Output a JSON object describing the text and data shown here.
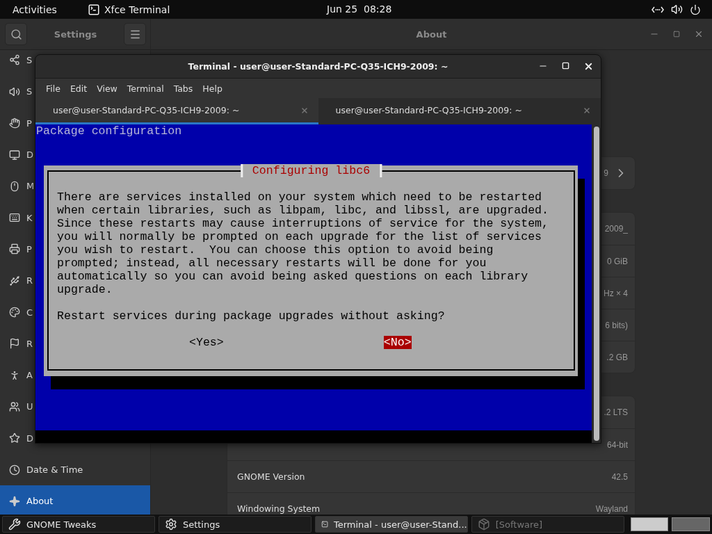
{
  "top_bar": {
    "activities": "Activities",
    "app_name": "Xfce Terminal",
    "clock": "Jun 25  08:28"
  },
  "settings": {
    "sidebar_title": "Settings",
    "page_title": "About",
    "sidebar_items": [
      {
        "label": "S",
        "selected": false
      },
      {
        "label": "S",
        "selected": false
      },
      {
        "label": "P",
        "selected": false
      },
      {
        "label": "D",
        "selected": false
      },
      {
        "label": "M",
        "selected": false
      },
      {
        "label": "K",
        "selected": false
      },
      {
        "label": "P",
        "selected": false
      },
      {
        "label": "R",
        "selected": false
      },
      {
        "label": "C",
        "selected": false
      },
      {
        "label": "R",
        "selected": false
      },
      {
        "label": "A",
        "selected": false
      },
      {
        "label": "U",
        "selected": false
      },
      {
        "label": "D",
        "selected": false
      },
      {
        "label": "Date & Time",
        "selected": false
      },
      {
        "label": "About",
        "selected": true
      }
    ],
    "groups": [
      {
        "rows": [
          {
            "kind": "link",
            "value": "9"
          }
        ]
      },
      {
        "rows": [
          {
            "kind": "info",
            "value": "2009_"
          },
          {
            "kind": "info",
            "value": "0 GiB"
          },
          {
            "kind": "info",
            "value": "Hz × 4"
          },
          {
            "kind": "info",
            "value": "6 bits)"
          },
          {
            "kind": "info",
            "value": ".2 GB"
          }
        ]
      },
      {
        "rows": [
          {
            "kind": "info",
            "value": ".2 LTS"
          },
          {
            "kind": "info",
            "value": "64-bit"
          },
          {
            "kind": "info",
            "label": "GNOME Version",
            "value": "42.5"
          },
          {
            "kind": "info",
            "label": "Windowing System",
            "value": "Wayland"
          }
        ]
      }
    ]
  },
  "terminal": {
    "title": "Terminal - user@user-Standard-PC-Q35-ICH9-2009: ~",
    "menu": [
      "File",
      "Edit",
      "View",
      "Terminal",
      "Tabs",
      "Help"
    ],
    "tabs": [
      {
        "label": "user@user-Standard-PC-Q35-ICH9-2009: ~",
        "selected": true
      },
      {
        "label": "user@user-Standard-PC-Q35-ICH9-2009: ~",
        "selected": false
      }
    ],
    "screen": {
      "header": "Package configuration",
      "dialog": {
        "title": "Configuring libc6",
        "body": "There are services installed on your system which need to be restarted\nwhen certain libraries, such as libpam, libc, and libssl, are upgraded.\nSince these restarts may cause interruptions of service for the system,\nyou will normally be prompted on each upgrade for the list of services\nyou wish to restart.  You can choose this option to avoid being\nprompted; instead, all necessary restarts will be done for you\nautomatically so you can avoid being asked questions on each library\nupgrade.",
        "question": "Restart services during package upgrades without asking?",
        "buttons": [
          {
            "label": "<Yes>",
            "selected": false
          },
          {
            "label": "<No>",
            "selected": true
          }
        ]
      }
    }
  },
  "taskbar": {
    "items": [
      {
        "label": "GNOME Tweaks",
        "selected": false,
        "disabled": false
      },
      {
        "label": "Settings",
        "selected": false,
        "disabled": false
      },
      {
        "label": "Terminal - user@user-Stand...",
        "selected": true,
        "disabled": false
      },
      {
        "label": "[Software]",
        "selected": false,
        "disabled": true
      }
    ],
    "workspaces": [
      {
        "selected": true
      },
      {
        "selected": false
      }
    ]
  }
}
